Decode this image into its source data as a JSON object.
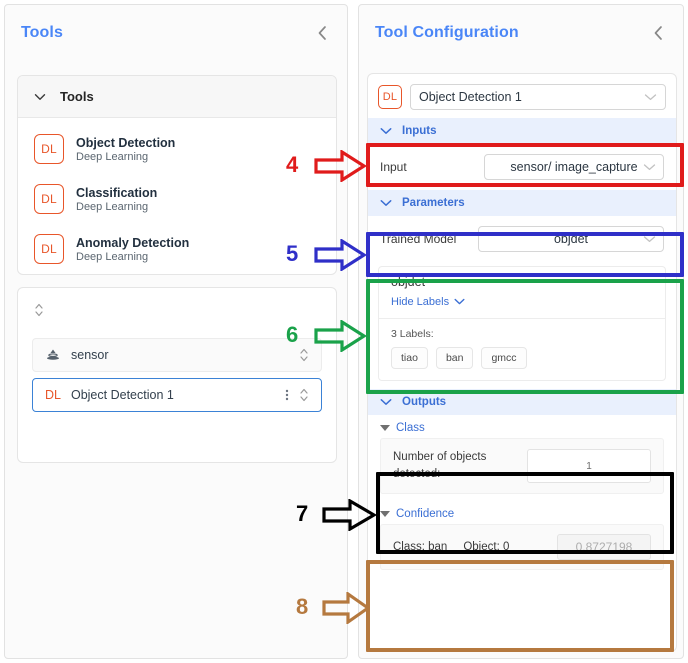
{
  "left_panel": {
    "title": "Tools",
    "collapse_icon": "chevron-left-icon",
    "tools_accordion": {
      "title": "Tools",
      "caret_icon": "chevron-down-icon",
      "items": [
        {
          "badge": "DL",
          "name": "Object Detection",
          "subtitle": "Deep Learning"
        },
        {
          "badge": "DL",
          "name": "Classification",
          "subtitle": "Deep Learning"
        },
        {
          "badge": "DL",
          "name": "Anomaly Detection",
          "subtitle": "Deep Learning"
        }
      ]
    },
    "pipeline": {
      "sort_icon": "sort-updown-icon",
      "rows": [
        {
          "icon": "sensor-icon",
          "badge": "",
          "label": "sensor",
          "handle_icon": "sort-updown-icon",
          "selected": false
        },
        {
          "icon": "",
          "badge": "DL",
          "label": "Object Detection 1",
          "kebab_icon": "kebab-menu-icon",
          "handle_icon": "sort-updown-icon",
          "selected": true
        }
      ]
    }
  },
  "right_panel": {
    "title": "Tool Configuration",
    "collapse_icon": "chevron-left-icon",
    "tool_select": {
      "badge": "DL",
      "value": "Object Detection 1",
      "chevron_icon": "chevron-down-icon"
    },
    "inputs_section": {
      "header": "Inputs",
      "chevron_icon": "chevron-down-icon",
      "field_label": "Input",
      "field_value": "sensor/ image_capture",
      "field_chevron_icon": "chevron-down-icon"
    },
    "parameters_section": {
      "header": "Parameters",
      "chevron_icon": "chevron-down-icon",
      "field_label": "Trained Model",
      "field_value": "objdet",
      "field_chevron_icon": "chevron-down-icon",
      "model_card": {
        "name": "objdet",
        "toggle_label": "Hide Labels",
        "toggle_icon": "chevron-down-icon",
        "labels_count": "3 Labels:",
        "labels": [
          "tiao",
          "ban",
          "gmcc"
        ]
      }
    },
    "outputs_section": {
      "header": "Outputs",
      "chevron_icon": "chevron-down-icon",
      "class_group": {
        "label": "Class",
        "triangle_icon": "triangle-down-icon",
        "row_label": "Number of objects detected:",
        "row_value": "1"
      },
      "confidence_group": {
        "label": "Confidence",
        "triangle_icon": "triangle-down-icon",
        "class_text": "Class: ban",
        "object_text": "Object: 0",
        "value": "0.8727198"
      }
    }
  },
  "annotations": [
    {
      "number": "4",
      "color": "#e01b1b",
      "target": "inputs-field-highlight"
    },
    {
      "number": "5",
      "color": "#2f2fc8",
      "target": "trained-model-field-highlight"
    },
    {
      "number": "6",
      "color": "#1aa24a",
      "target": "model-labels-card-highlight"
    },
    {
      "number": "7",
      "color": "#000000",
      "target": "class-output-highlight"
    },
    {
      "number": "8",
      "color": "#b5793f",
      "target": "confidence-output-highlight"
    }
  ]
}
